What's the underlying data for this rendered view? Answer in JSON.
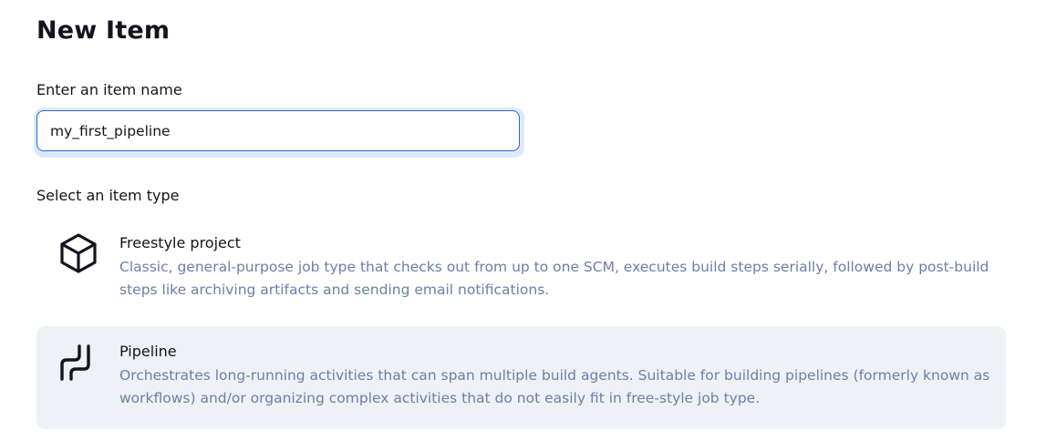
{
  "page": {
    "title": "New Item"
  },
  "name_field": {
    "label": "Enter an item name",
    "value": "my_first_pipeline"
  },
  "item_type_section": {
    "label": "Select an item type",
    "types": [
      {
        "name": "Freestyle project",
        "description": "Classic, general-purpose job type that checks out from up to one SCM, executes build steps serially, followed by post-build steps like archiving artifacts and sending email notifications.",
        "icon": "box-icon",
        "selected": false
      },
      {
        "name": "Pipeline",
        "description": "Orchestrates long-running activities that can span multiple build agents. Suitable for building pipelines (formerly known as workflows) and/or organizing complex activities that do not easily fit in free-style job type.",
        "icon": "pipeline-icon",
        "selected": true
      }
    ]
  },
  "colors": {
    "accent": "#2e67c7",
    "description_text": "#6b7fa8",
    "selected_bg": "#eef1f6"
  }
}
